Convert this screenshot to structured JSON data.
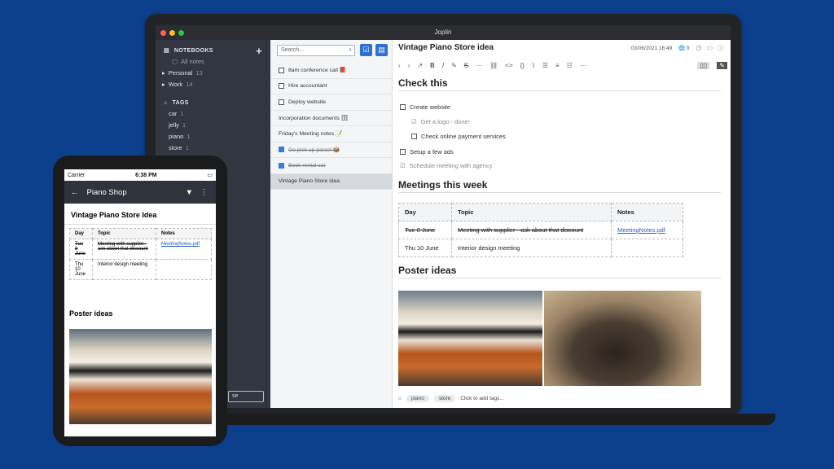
{
  "window": {
    "title": "Joplin"
  },
  "sidebar": {
    "notebooks_label": "NOTEBOOKS",
    "notebooks": [
      {
        "label": "All notes",
        "count": ""
      },
      {
        "label": "Personal",
        "count": "13"
      },
      {
        "label": "Work",
        "count": "14"
      }
    ],
    "tags_label": "TAGS",
    "tags": [
      {
        "label": "car",
        "count": "1"
      },
      {
        "label": "jelly",
        "count": "1"
      },
      {
        "label": "piano",
        "count": "1"
      },
      {
        "label": "store",
        "count": "1"
      }
    ],
    "bottom_button_fragment": "se"
  },
  "notelist": {
    "search_placeholder": "Search...",
    "notes": [
      {
        "label": "8am conference call 📕",
        "checkbox": true,
        "checked": false
      },
      {
        "label": "Hire accountant",
        "checkbox": true,
        "checked": false
      },
      {
        "label": "Deploy website",
        "checkbox": true,
        "checked": false
      },
      {
        "label": "Incorporation documents 🗄",
        "checkbox": false,
        "checked": false
      },
      {
        "label": "Friday's Meeting notes 📝",
        "checkbox": false,
        "checked": false
      },
      {
        "label": "Go pick up parcel 📦",
        "checkbox": true,
        "checked": true
      },
      {
        "label": "Book rental car",
        "checkbox": true,
        "checked": true
      },
      {
        "label": "Vintage Piano Store idea",
        "checkbox": false,
        "checked": false,
        "selected": true
      }
    ]
  },
  "editor": {
    "title": "Vintage Piano Store idea",
    "date": "03/06/2021 16:49",
    "lang": "fr",
    "heading1": "Check this",
    "checklist": [
      {
        "label": "Create website",
        "done": false,
        "sub": false
      },
      {
        "label": "Get a logo - done!",
        "done": true,
        "sub": true
      },
      {
        "label": "Check online payment services",
        "done": false,
        "sub": true
      },
      {
        "label": "Setup a few ads",
        "done": false,
        "sub": false
      },
      {
        "label": "Schedule meeting with agency",
        "done": true,
        "sub": false
      }
    ],
    "heading2": "Meetings this week",
    "table": {
      "headers": [
        "Day",
        "Topic",
        "Notes"
      ],
      "rows": [
        [
          "Tue 8 June",
          "Meeting with supplier - ask about that discount",
          "MeetingNotes.pdf"
        ],
        [
          "Thu 10 June",
          "Interior design meeting",
          ""
        ]
      ]
    },
    "heading3": "Poster ideas",
    "tags": [
      "piano",
      "store"
    ],
    "add_tags": "Click to add tags..."
  },
  "phone": {
    "carrier": "Carrier",
    "time": "6:38 PM",
    "notebook": "Piano Shop",
    "title": "Vintage Piano Store Idea",
    "table": {
      "headers": [
        "Day",
        "Topic",
        "Notes"
      ],
      "rows": [
        [
          "Tue 8 June",
          "Meeting with supplier - ask about that discount",
          "MeetingNotes.pdf"
        ],
        [
          "Thu 10 June",
          "Interior design meeting",
          ""
        ]
      ]
    },
    "poster_heading": "Poster ideas"
  },
  "colors": {
    "background": "#0b3f8c",
    "accent": "#2d6fd6",
    "sidebar": "#313640"
  }
}
